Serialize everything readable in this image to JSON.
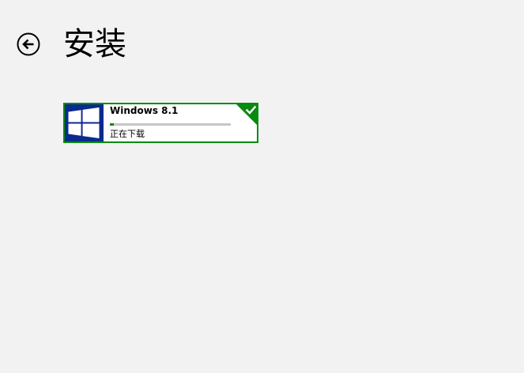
{
  "page": {
    "title": "安装"
  },
  "installs": [
    {
      "name": "Windows 8.1",
      "status": "正在下载",
      "progress": 0.03,
      "selected": true
    }
  ],
  "icons": {
    "back": "back-arrow-icon",
    "tile_logo": "windows-logo-icon",
    "selected": "checkmark-icon"
  },
  "colors": {
    "background": "#f2f2f2",
    "accent": "#078b0d",
    "tile_logo_background": "#0b2a8f",
    "progress_track": "#c6c6c6",
    "progress_fill": "#078b0d"
  }
}
